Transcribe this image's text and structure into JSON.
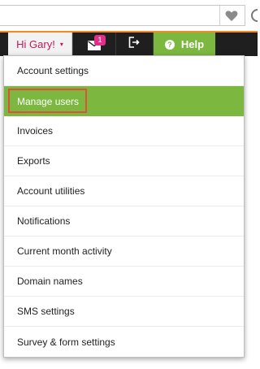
{
  "colors": {
    "accent": "#7cb740",
    "greeting": "#c2185b",
    "badge": "#e0308a",
    "navbar": "#1f1f1f",
    "highlight_border": "#e0513a"
  },
  "icons": {
    "favorite": "heart-icon",
    "reload": "reload-icon",
    "messages": "envelope-icon",
    "logout": "logout-icon",
    "help": "help-circle-icon"
  },
  "topnav": {
    "greeting": "Hi Gary!",
    "caret": "▾",
    "message_count": "1",
    "help_label": "Help",
    "help_symbol": "?"
  },
  "menu": {
    "items": [
      {
        "label": "Account settings"
      },
      {
        "label": "Manage users",
        "active": true
      },
      {
        "label": "Invoices"
      },
      {
        "label": "Exports"
      },
      {
        "label": "Account utilities"
      },
      {
        "label": "Notifications"
      },
      {
        "label": "Current month activity"
      },
      {
        "label": "Domain names"
      },
      {
        "label": "SMS settings"
      },
      {
        "label": "Survey & form settings"
      }
    ]
  }
}
